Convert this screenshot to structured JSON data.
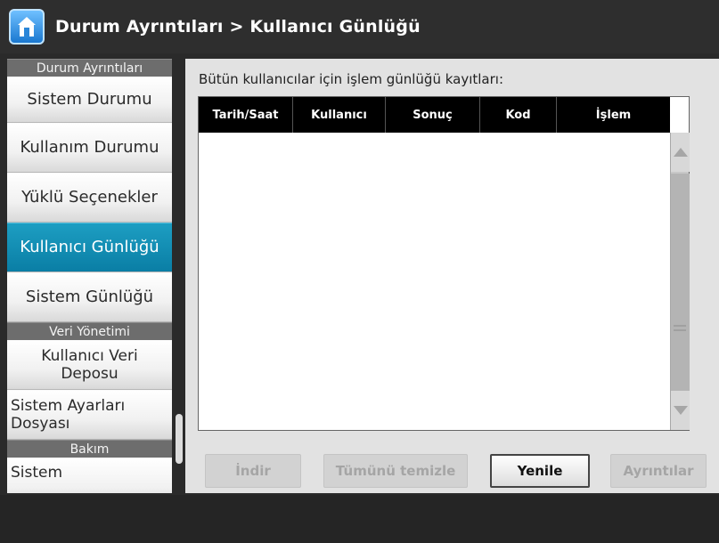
{
  "header": {
    "home_icon": "home-icon",
    "title": "Durum Ayrıntıları > Kullanıcı Günlüğü"
  },
  "sidebar": {
    "sections": [
      {
        "title": "Durum Ayrıntıları",
        "items": [
          {
            "label": "Sistem Durumu",
            "active": false
          },
          {
            "label": "Kullanım Durumu",
            "active": false
          },
          {
            "label": "Yüklü Seçenekler",
            "active": false
          },
          {
            "label": "Kullanıcı Günlüğü",
            "active": true
          },
          {
            "label": "Sistem Günlüğü",
            "active": false
          }
        ]
      },
      {
        "title": "Veri Yönetimi",
        "items": [
          {
            "label": "Kullanıcı Veri Deposu"
          },
          {
            "label": "Sistem Ayarları Dosyası"
          }
        ]
      },
      {
        "title": "Bakım",
        "items": [
          {
            "label": "Sistem"
          }
        ]
      }
    ]
  },
  "content": {
    "label": "Bütün kullanıcılar için işlem günlüğü kayıtları:",
    "table": {
      "columns": [
        "Tarih/Saat",
        "Kullanıcı",
        "Sonuç",
        "Kod",
        "İşlem"
      ],
      "rows": []
    },
    "buttons": {
      "download": "İndir",
      "clear_all": "Tümünü temizle",
      "refresh": "Yenile",
      "details": "Ayrıntılar"
    }
  },
  "colors": {
    "active_item": "#0a7ea5",
    "header_bg": "#2e2e2e",
    "table_header_bg": "#000000"
  }
}
